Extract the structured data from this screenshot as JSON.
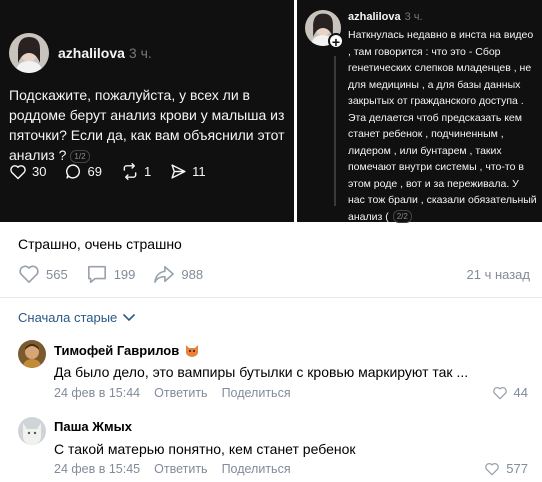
{
  "post_left": {
    "username": "azhalilova",
    "time": "3 ч.",
    "text": "Подскажите, пожалуйста, у всех ли в роддоме берут анализ крови у малыша из пяточки? Если да, как вам объяснили этот анализ ?",
    "pager": "1/2",
    "stats": {
      "likes": "30",
      "comments": "69",
      "reposts": "1",
      "shares": "11"
    }
  },
  "post_right": {
    "username": "azhalilova",
    "time": "3 ч.",
    "text": "Наткнулась недавно в инста на видео , там говорится : что это - Сбор генетических слепков младенцев , не для медицины , а для базы данных закрытых от гражданского доступа . Эта делается чтоб предсказать кем станет ребенок , подчиненным , лидером , или бунтарем , таких помечают внутри системы , что-то в этом роде , вот и за переживала. У нас тож брали , сказали обязательный анализ (",
    "pager": "2/2"
  },
  "post": {
    "caption": "Страшно, очень страшно",
    "likes": "565",
    "comments": "199",
    "reposts": "988",
    "time": "21 ч назад"
  },
  "comments_sort": {
    "label": "Сначала старые"
  },
  "comments": [
    {
      "author": "Тимофей Гаврилов",
      "text": "Да было дело, это вампиры бутылки с кровью маркируют так ...",
      "date": "24 фев в 15:44",
      "reply": "Ответить",
      "share": "Поделиться",
      "likes": "44"
    },
    {
      "author": "Паша Жмых",
      "text": "С такой матерью понятно, кем станет ребенок",
      "date": "24 фев в 15:45",
      "reply": "Ответить",
      "share": "Поделиться",
      "likes": "577"
    }
  ],
  "colors": {
    "dark_bg": "#101010",
    "link": "#2a5885",
    "meta": "#818c99",
    "like_red": "#e64646"
  }
}
